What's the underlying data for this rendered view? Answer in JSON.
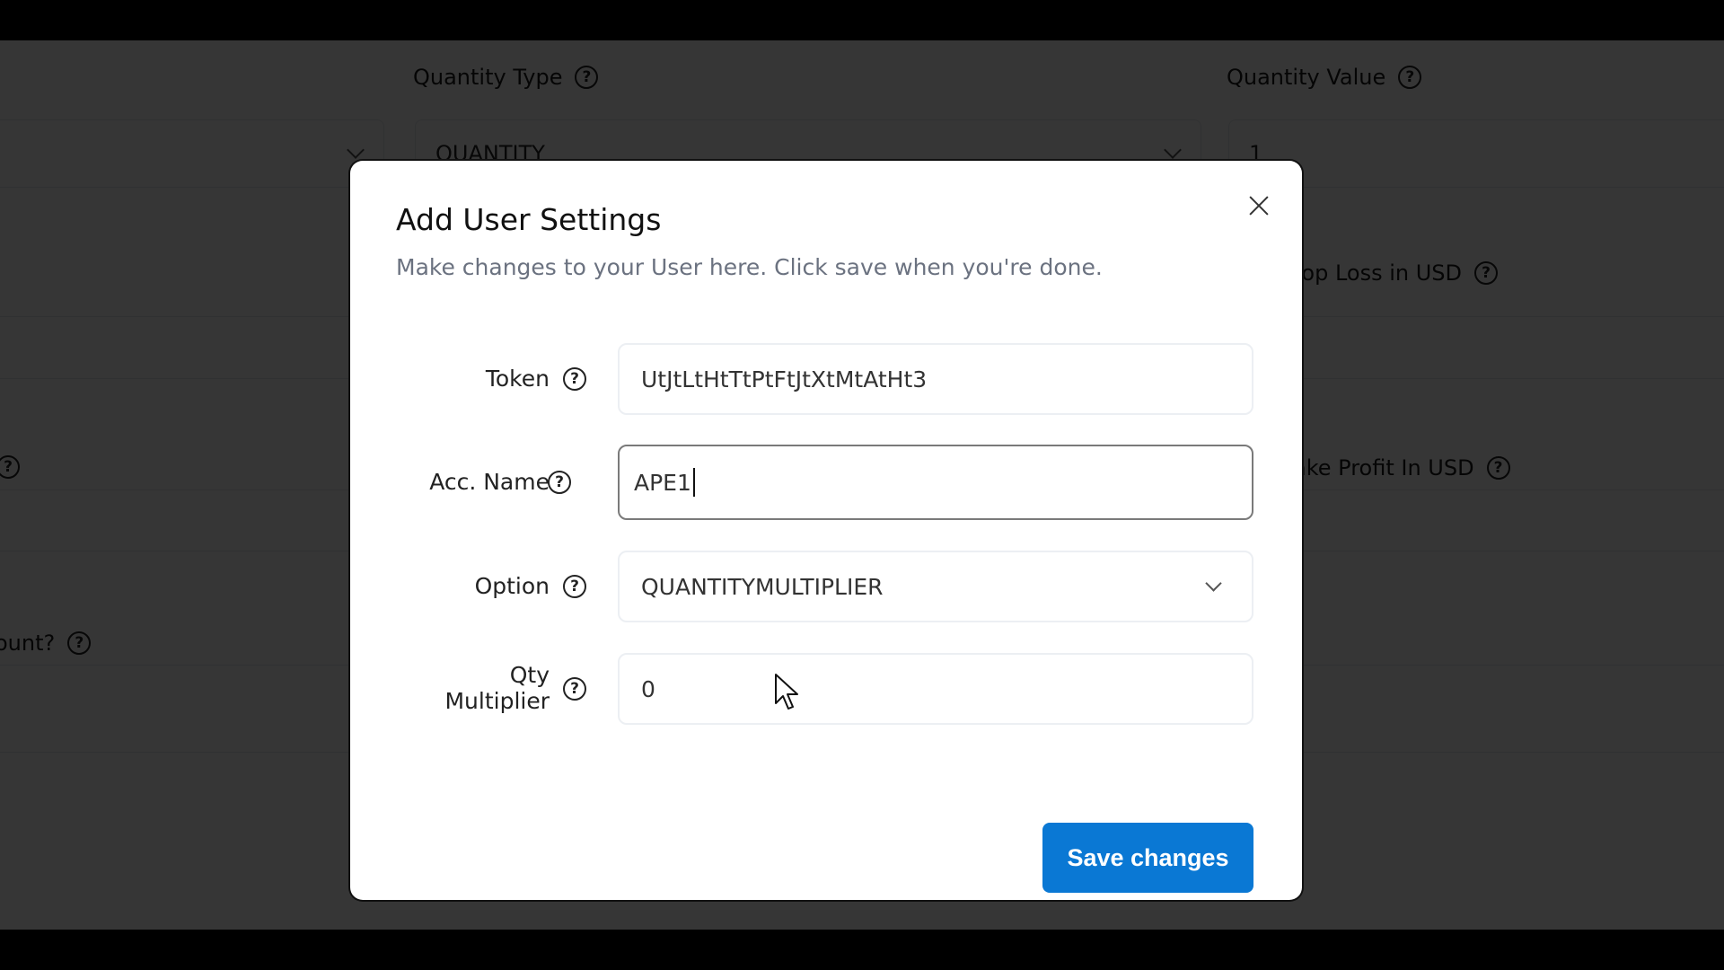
{
  "background": {
    "fields": [
      {
        "label": "Quantity Type",
        "value": "QUANTITY",
        "type": "select"
      },
      {
        "label": "Quantity Value",
        "value": "1",
        "type": "input"
      },
      {
        "label": "Stop Loss in USD",
        "visible_label": "top Loss in USD"
      },
      {
        "label": "Take Profit In USD",
        "visible_label": "ake Profit In USD"
      },
      {
        "visible_label": "ount?"
      }
    ]
  },
  "modal": {
    "title": "Add User Settings",
    "subtitle": "Make changes to your User here. Click save when you're done.",
    "close_icon": "close-icon",
    "fields": [
      {
        "label": "Token",
        "value": "UtJtLtHtTtPtFtJtXtMtAtHt3",
        "type": "input",
        "help_icon": "question-circle-icon"
      },
      {
        "label": "Acc. Name",
        "value": "APE1",
        "type": "input",
        "focused": true,
        "help_icon": "question-circle-icon"
      },
      {
        "label": "Option",
        "value": "QUANTITYMULTIPLIER",
        "type": "select",
        "help_icon": "question-circle-icon"
      },
      {
        "label_line1": "Qty",
        "label_line2": "Multiplier",
        "value": "0",
        "type": "input",
        "help_icon": "question-circle-icon"
      }
    ],
    "save_label": "Save changes",
    "accent_color": "#0a78d4"
  },
  "help_glyph": "?"
}
